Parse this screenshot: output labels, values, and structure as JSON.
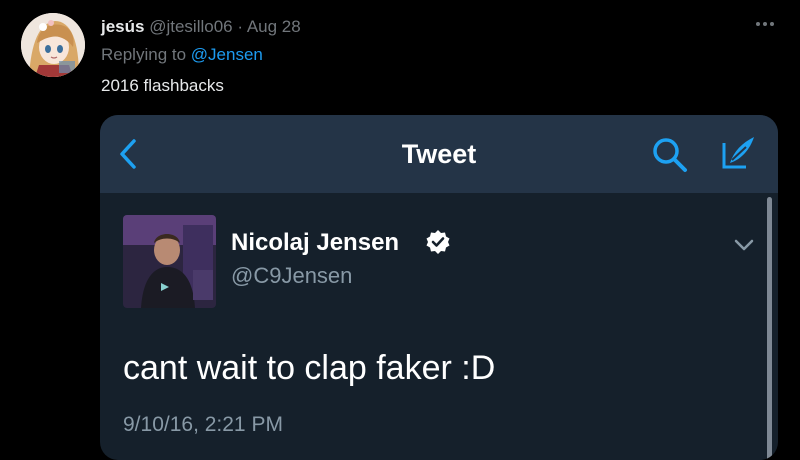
{
  "reply": {
    "display_name": "jesús",
    "handle": "@jtesillo06",
    "separator": "·",
    "date": "Aug 28",
    "replying_prefix": "Replying to",
    "replying_to": "@Jensen",
    "text": "2016 flashbacks",
    "more_icon": "more-horizontal-icon"
  },
  "media": {
    "title": "Tweet",
    "back_icon": "chevron-left-icon",
    "search_icon": "search-icon",
    "compose_icon": "compose-icon",
    "author_name": "Nicolaj Jensen",
    "author_handle": "@C9Jensen",
    "verified_icon": "verified-badge-icon",
    "caret_icon": "chevron-down-icon",
    "text": "cant wait to clap faker :D",
    "timestamp": "9/10/16, 2:21 PM"
  },
  "colors": {
    "background": "#000000",
    "link": "#1d9bf0",
    "secondary_text": "#71767b",
    "media_background": "#15202b",
    "media_bar": "#243447",
    "icon_accent": "#1da1f2"
  }
}
